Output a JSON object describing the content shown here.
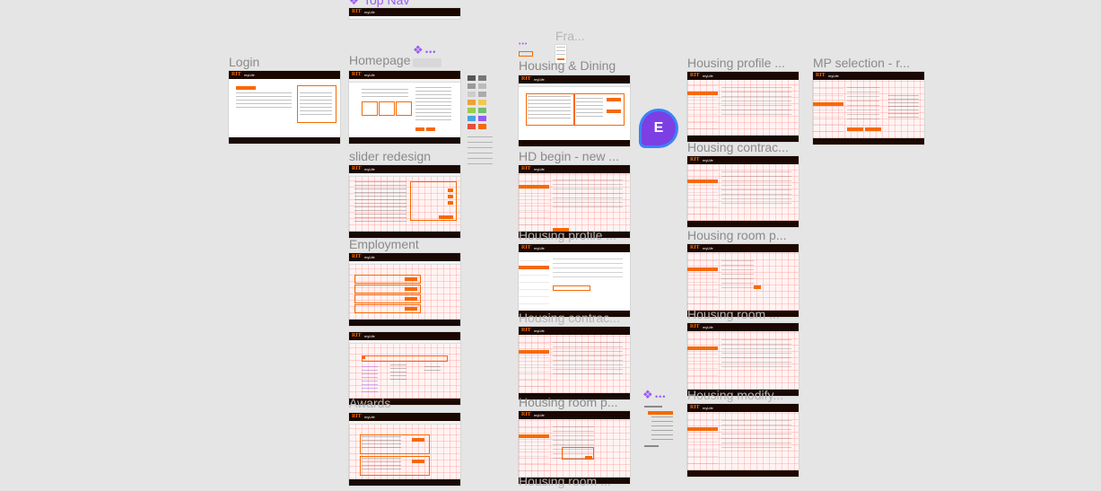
{
  "labels": {
    "top_nav": "Top Nav",
    "login": "Login",
    "homepage": "Homepage",
    "fra": "Fra...",
    "housing_dining": "Housing & Dining",
    "housing_profile": "Housing profile ...",
    "mp_selection": "MP selection - r...",
    "slider_redesign": "slider redesign",
    "hd_begin": "HD begin - new ...",
    "housing_contract_right": "Housing contrac...",
    "employment": "Employment",
    "housing_profile_mid": "Housing profile ...",
    "housing_room_right": "Housing room p...",
    "housing_contract_mid": "Housing contrac...",
    "housing_room_right2": "Housing room ...",
    "awards": "Awards",
    "housing_room_mid": "Housing room p...",
    "housing_modify": "Housing modify...",
    "housing_room_bottom": "Housing room ..."
  },
  "brand": {
    "logo": "RIT",
    "app": "myLife",
    "accent": "#f76902",
    "header": "#1a0800"
  },
  "avatar": {
    "initial": "E",
    "bg": "#7b3fe4",
    "ring": "#3b82f6"
  },
  "component_icon": "component-diamond-icon",
  "dots": "•••"
}
